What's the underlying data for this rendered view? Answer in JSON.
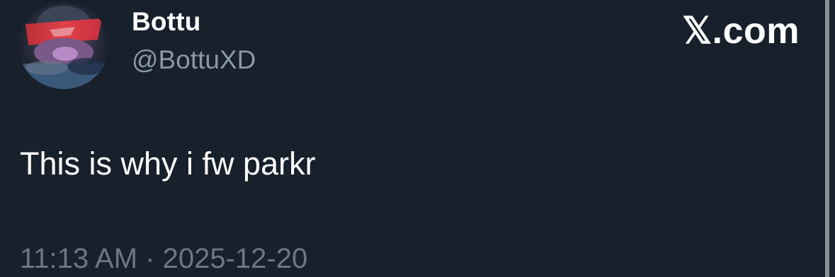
{
  "tweet": {
    "display_name": "Bottu",
    "handle": "@BottuXD",
    "text": "This is why i fw parkr",
    "timestamp": "11:13 AM · 2025-12-20"
  },
  "brand": {
    "site_mark": "𝕏.com"
  },
  "colors": {
    "background": "#17202b",
    "primary_text": "#ffffff",
    "secondary_text": "#8b98a5",
    "timestamp_text": "#6b7884"
  },
  "icons": {
    "avatar": "avatar-image"
  }
}
